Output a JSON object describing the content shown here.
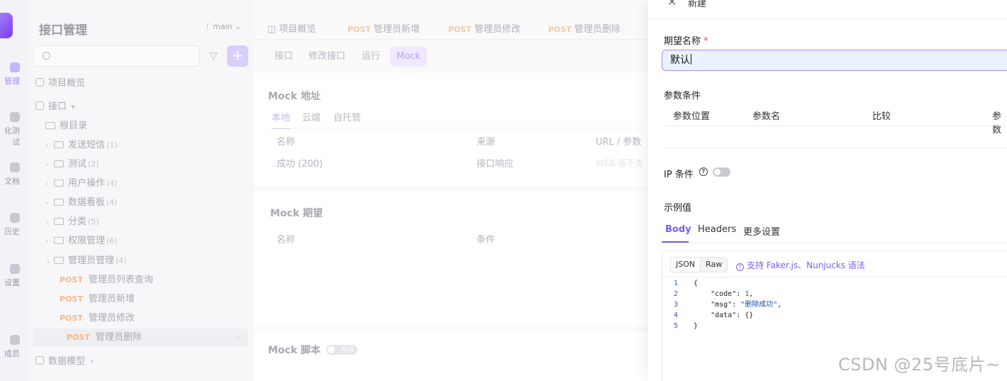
{
  "rail": {
    "items": [
      {
        "label": "管理",
        "icon": "api-icon",
        "active": true
      },
      {
        "label": "化测试",
        "icon": "test-icon"
      },
      {
        "label": "文档",
        "icon": "doc-icon"
      },
      {
        "label": "历史",
        "icon": "history-icon"
      },
      {
        "label": "设置",
        "icon": "settings-icon"
      },
      {
        "label": "成员",
        "icon": "members-icon"
      }
    ]
  },
  "sidebar": {
    "title": "接口管理",
    "branch": "main",
    "tree": {
      "overview": "项目概览",
      "api_root": "接口",
      "root_dir": "根目录",
      "folders": [
        {
          "name": "发送短信",
          "count": "(1)"
        },
        {
          "name": "测试",
          "count": "(2)"
        },
        {
          "name": "用户操作",
          "count": "(4)"
        },
        {
          "name": "数据看板",
          "count": "(4)"
        },
        {
          "name": "分类",
          "count": "(5)"
        },
        {
          "name": "权限管理",
          "count": "(6)"
        },
        {
          "name": "管理员管理",
          "count": "(4)"
        }
      ],
      "apis": [
        {
          "method": "POST",
          "name": "管理员列表查询"
        },
        {
          "method": "POST",
          "name": "管理员新增"
        },
        {
          "method": "POST",
          "name": "管理员修改"
        },
        {
          "method": "POST",
          "name": "管理员删除"
        }
      ],
      "data_model": "数据模型"
    }
  },
  "main": {
    "tabs": [
      {
        "method": "",
        "label": "项目概览"
      },
      {
        "method": "POST",
        "label": "管理员新增"
      },
      {
        "method": "POST",
        "label": "管理员修改"
      },
      {
        "method": "POST",
        "label": "管理员删除"
      }
    ],
    "subtabs": [
      "接口",
      "修改接口",
      "运行",
      "Mock"
    ],
    "mock_address": {
      "title": "Mock 地址",
      "tabs": [
        "本地",
        "云端",
        "自托管"
      ],
      "headers": [
        "名称",
        "来源",
        "URL / 参数"
      ],
      "row": {
        "name": "成功 (200)",
        "source": "接口响应",
        "url": "WEB 版不支"
      }
    },
    "mock_expect": {
      "title": "Mock 期望",
      "headers": [
        "名称",
        "条件"
      ]
    },
    "mock_script": {
      "title": "Mock 脚本",
      "toggle": "关闭"
    }
  },
  "drawer": {
    "title": "新建",
    "name_label": "期望名称",
    "required_mark": "*",
    "name_value": "默认",
    "params_label": "参数条件",
    "params_headers": [
      "参数位置",
      "参数名",
      "比较",
      "参数"
    ],
    "ip_label": "IP 条件",
    "example_label": "示例值",
    "example_tabs": [
      "Body",
      "Headers",
      "更多设置"
    ],
    "format_options": [
      "JSON",
      "Raw"
    ],
    "faker_link": "支持 Faker.js、Nunjucks 语法",
    "code_lines": [
      {
        "n": "1",
        "t": "{"
      },
      {
        "n": "2",
        "key": "\"code\"",
        "val": "1",
        "type": "num"
      },
      {
        "n": "3",
        "key": "\"msg\"",
        "val": "\"删除成功\"",
        "type": "str"
      },
      {
        "n": "4",
        "key": "\"data\"",
        "val": "{}",
        "type": "obj"
      },
      {
        "n": "5",
        "t": "}"
      }
    ]
  },
  "watermark": "CSDN @25号底片~",
  "colors": {
    "accent": "#7c5cf0",
    "post": "#f6b88a",
    "required": "#e5484d"
  }
}
